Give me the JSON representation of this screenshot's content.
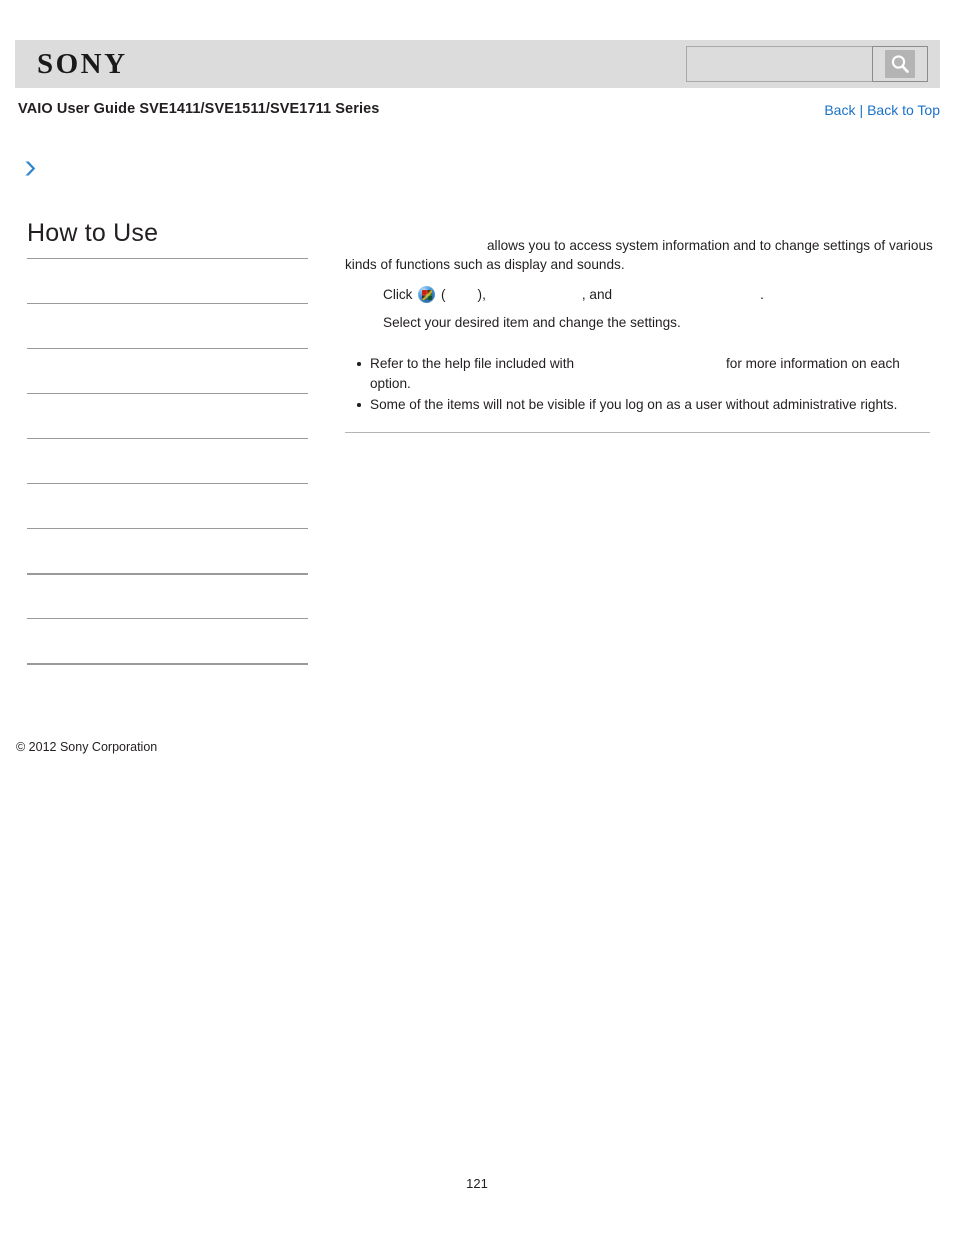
{
  "header": {
    "logo_text": "SONY",
    "search": {
      "value": "",
      "placeholder": "",
      "button_icon": "search-icon"
    }
  },
  "subheader": {
    "guide_title": "VAIO User Guide SVE1411/SVE1511/SVE1711 Series",
    "back_label": "Back",
    "separator": "|",
    "back_to_top_label": "Back to Top"
  },
  "breadcrumb": {
    "arrow_icon": "chevron-right-icon",
    "text": ""
  },
  "sidebar": {
    "title": "How to Use",
    "items": [
      {
        "label": ""
      },
      {
        "label": ""
      },
      {
        "label": ""
      },
      {
        "label": ""
      },
      {
        "label": ""
      },
      {
        "label": ""
      },
      {
        "label": ""
      },
      {
        "label": ""
      },
      {
        "label": ""
      },
      {
        "label": ""
      },
      {
        "label": ""
      }
    ]
  },
  "main": {
    "intro": {
      "lead_blank": "",
      "text_1": "allows you to access system information and to change settings of various kinds of functions such as display and sounds.",
      "full_text": "allows you to access system information and to change settings of various kinds of functions such as display and sounds."
    },
    "steps": [
      {
        "prefix": "Click",
        "icon": "windows-start-orb-icon",
        "open_paren": "(",
        "blank_1": "",
        "close_paren": "),",
        "blank_2": "",
        "middle": ", and",
        "blank_3": "",
        "suffix": "."
      },
      {
        "text": "Select your desired item and change the settings."
      }
    ],
    "notes": [
      {
        "part_1": "Refer to the help file included with",
        "blank": "",
        "part_2": "for more information on each option."
      },
      {
        "part_1": "Some of the items will not be visible if you log on as a user without administrative rights.",
        "blank": "",
        "part_2": ""
      }
    ]
  },
  "footer": {
    "copyright": "© 2012 Sony Corporation",
    "page_number": "121"
  },
  "colors": {
    "header_bg": "#dcdcdc",
    "link_blue": "#1a72c8",
    "accent_arrow": "#2f86cd",
    "rule_gray": "#9a9a9a",
    "text": "#231f20"
  }
}
